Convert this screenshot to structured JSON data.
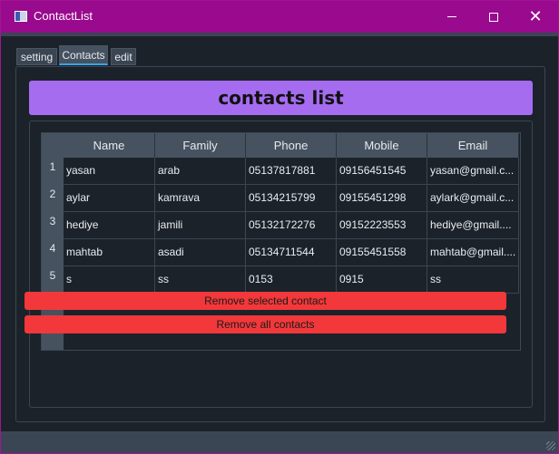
{
  "window": {
    "title": "ContactList",
    "icon": "app-window-icon",
    "controls": [
      "minimize-icon",
      "maximize-icon",
      "close-icon"
    ]
  },
  "tabs": [
    {
      "label": "setting",
      "selected": false
    },
    {
      "label": "Contacts",
      "selected": true
    },
    {
      "label": "edit",
      "selected": false
    }
  ],
  "main": {
    "heading": "contacts list",
    "table": {
      "columns": [
        "Name",
        "Family",
        "Phone",
        "Mobile",
        "Email"
      ],
      "row_numbers": [
        "1",
        "2",
        "3",
        "4",
        "5"
      ],
      "rows": [
        [
          "yasan",
          "arab",
          "05137817881",
          "09156451545",
          "yasan@gmail.c..."
        ],
        [
          "aylar",
          "kamrava",
          "05134215799",
          "09155451298",
          "aylark@gmail.c..."
        ],
        [
          "hediye",
          "jamili",
          "05132172276",
          "09152223553",
          "hediye@gmail...."
        ],
        [
          "mahtab",
          "asadi",
          "05134711544",
          "09155451558",
          "mahtab@gmail...."
        ],
        [
          "s",
          "ss",
          "0153",
          "0915",
          "ss"
        ]
      ]
    },
    "buttons": {
      "remove_selected": "Remove selected contact",
      "remove_all": "Remove all contacts"
    }
  },
  "colors": {
    "titlebar": "#9a0a8e",
    "header": "#a56cf0",
    "danger": "#f2383a",
    "tab_accent": "#3aa3e8",
    "background": "#1b222a"
  }
}
